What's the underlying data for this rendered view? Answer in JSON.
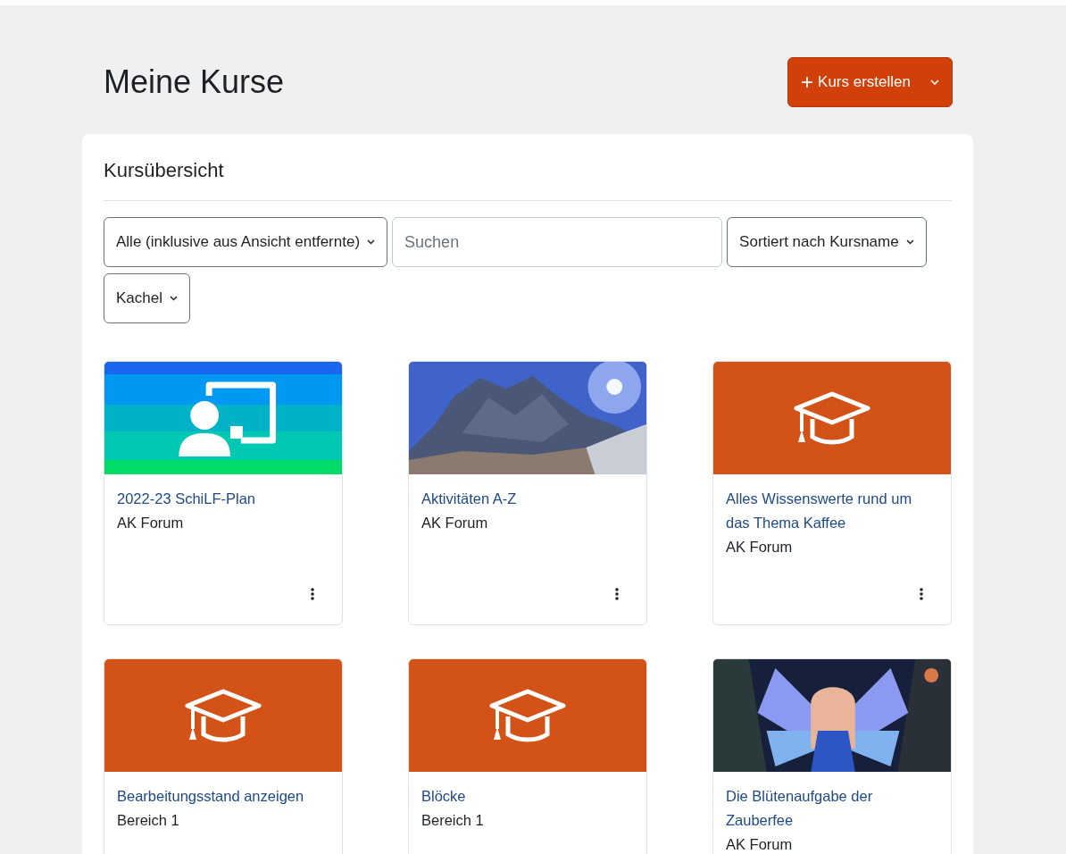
{
  "page_title": "Meine Kurse",
  "create_button": {
    "label": "Kurs erstellen",
    "icon": "+",
    "has_dropdown": true
  },
  "panel": {
    "title": "Kursübersicht",
    "filters": [
      {
        "kind": "select",
        "value": "Alle (inklusive aus Ansicht entfernte)"
      },
      {
        "kind": "search",
        "placeholder": "Suchen"
      },
      {
        "kind": "select",
        "value": "Sortiert nach Kursname"
      },
      {
        "kind": "select",
        "value": "Kachel"
      }
    ],
    "courses": [
      {
        "title": "2022-23 SchiLF-Plan",
        "category": "AK Forum",
        "kind": "pattern",
        "menu": true
      },
      {
        "title": "Aktivitäten A-Z",
        "category": "AK Forum",
        "kind": "picture",
        "menu": true
      },
      {
        "title": "Alles Wissenswerte rund um das Thema Kaffee",
        "category": "AK Forum",
        "kind": "cap",
        "menu": true
      },
      {
        "title": "Bearbeitungsstand anzeigen",
        "category": "Bereich 1",
        "kind": "cap",
        "menu": false
      },
      {
        "title": "Blöcke",
        "category": "Bereich 1",
        "kind": "cap",
        "menu": false
      },
      {
        "title": "Die Blütenaufgabe der Zauberfee",
        "category": "AK Forum",
        "kind": "picture",
        "menu": false
      }
    ]
  }
}
